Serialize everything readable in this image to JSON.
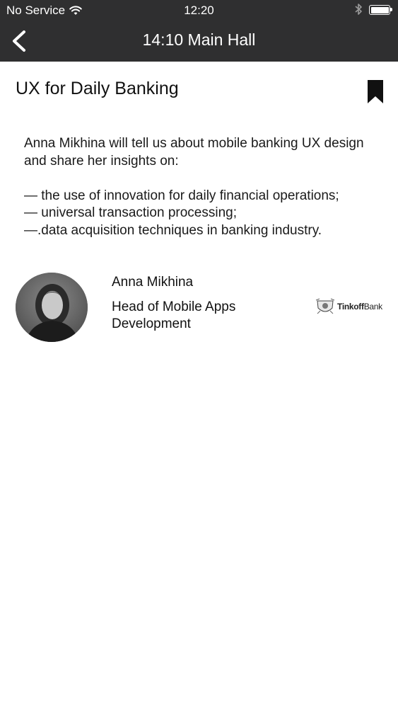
{
  "status_bar": {
    "carrier": "No Service",
    "time": "12:20",
    "wifi_icon": "wifi-icon",
    "bluetooth_icon": "bluetooth-icon",
    "battery_icon": "battery-icon"
  },
  "navbar": {
    "title": "14:10 Main Hall",
    "back_icon": "chevron-left-icon",
    "background": "#2f2f30"
  },
  "session": {
    "title": "UX for Daily Banking",
    "bookmark_icon": "bookmark-icon",
    "intro": "Anna Mikhina will tell us about mobile banking UX design and share her insights on:",
    "points": [
      "— the use of innovation for daily financial operations;",
      "— universal transaction processing;",
      "—.data acquisition techniques in banking industry."
    ]
  },
  "speaker": {
    "name": "Anna Mikhina",
    "role": "Head of Mobile Apps Development",
    "company": {
      "name_bold": "Tinkoff",
      "name_light": "Bank"
    }
  }
}
